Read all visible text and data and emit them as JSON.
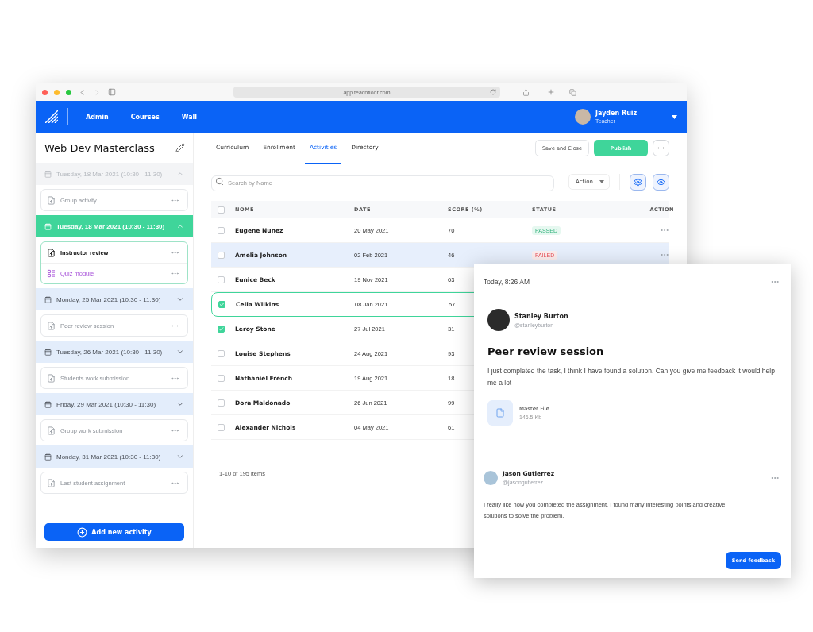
{
  "browser": {
    "url": "app.teachfloor.com"
  },
  "nav": {
    "items": [
      {
        "label": "Admin"
      },
      {
        "label": "Courses"
      },
      {
        "label": "Wall"
      }
    ],
    "user": {
      "name": "Jayden Ruiz",
      "role": "Teacher"
    }
  },
  "course": {
    "title": "Web Dev Masterclass"
  },
  "sessions": [
    {
      "date": "Tuesday, 18 Mar 2021 (10:30 - 11:30)",
      "dimmed": true,
      "selected": false,
      "expanded": true,
      "activities": [
        {
          "title": "Group activity",
          "kind": "assignment",
          "active": false
        }
      ]
    },
    {
      "date": "Tuesday, 18 Mar 2021 (10:30 - 11:30)",
      "dimmed": false,
      "selected": true,
      "expanded": true,
      "activities": [
        {
          "title": "Instructor review",
          "kind": "assignment",
          "active": true
        },
        {
          "title": "Quiz module",
          "kind": "quiz",
          "active": false
        }
      ]
    },
    {
      "date": "Monday, 25 Mar 2021 (10:30 - 11:30)",
      "dimmed": false,
      "selected": false,
      "expanded": false,
      "activities": [
        {
          "title": "Peer review session",
          "kind": "assignment",
          "active": false
        }
      ]
    },
    {
      "date": "Tuesday, 26 Mar 2021 (10:30 - 11:30)",
      "dimmed": false,
      "selected": false,
      "expanded": false,
      "activities": [
        {
          "title": "Students work submission",
          "kind": "assignment",
          "active": false
        }
      ]
    },
    {
      "date": "Friday, 29 Mar 2021 (10:30 - 11:30)",
      "dimmed": false,
      "selected": false,
      "expanded": false,
      "activities": [
        {
          "title": "Group work submission",
          "kind": "assignment",
          "active": false
        }
      ]
    },
    {
      "date": "Monday, 31 Mar 2021 (10:30 - 11:30)",
      "dimmed": false,
      "selected": false,
      "expanded": false,
      "activities": [
        {
          "title": "Last student assignment",
          "kind": "assignment",
          "active": false
        }
      ]
    }
  ],
  "add_button": "Add new activity",
  "tabs": [
    {
      "label": "Curriculum",
      "selected": false
    },
    {
      "label": "Enrollment",
      "selected": false
    },
    {
      "label": "Activities",
      "selected": true
    },
    {
      "label": "Directory",
      "selected": false
    }
  ],
  "header_buttons": {
    "save": "Save and Close",
    "publish": "Publish"
  },
  "search": {
    "placeholder": "Search by Name"
  },
  "action_select": "Action",
  "table": {
    "all_checked": false,
    "columns": [
      "NOME",
      "DATE",
      "SCORE (%)",
      "STATUS",
      "ACTION"
    ],
    "rows": [
      {
        "name": "Eugene Nunez",
        "date": "20 May 2021",
        "score": "70",
        "status": {
          "label": "PASSED",
          "kind": "passed"
        },
        "checked": false,
        "highlighted": false,
        "focused": false
      },
      {
        "name": "Amelia Johnson",
        "date": "02 Feb 2021",
        "score": "46",
        "status": {
          "label": "FAILED",
          "kind": "failed"
        },
        "checked": false,
        "highlighted": true,
        "focused": false
      },
      {
        "name": "Eunice Beck",
        "date": "19 Nov 2021",
        "score": "63",
        "checked": false,
        "highlighted": false,
        "focused": false
      },
      {
        "name": "Celia Wilkins",
        "date": "08 Jan 2021",
        "score": "57",
        "checked": true,
        "highlighted": false,
        "focused": true
      },
      {
        "name": "Leroy Stone",
        "date": "27 Jul 2021",
        "score": "31",
        "checked": true,
        "highlighted": false,
        "focused": false
      },
      {
        "name": "Louise Stephens",
        "date": "24 Aug 2021",
        "score": "93",
        "checked": false,
        "highlighted": false,
        "focused": false
      },
      {
        "name": "Nathaniel French",
        "date": "19 Aug 2021",
        "score": "18",
        "checked": false,
        "highlighted": false,
        "focused": false
      },
      {
        "name": "Dora Maldonado",
        "date": "26 Jun 2021",
        "score": "99",
        "checked": false,
        "highlighted": false,
        "focused": false
      },
      {
        "name": "Alexander Nichols",
        "date": "04 May 2021",
        "score": "61",
        "checked": false,
        "highlighted": false,
        "focused": false
      }
    ]
  },
  "pagination": "1-10 of 195 items",
  "post": {
    "time": "Today, 8:26 AM",
    "author": {
      "name": "Stanley Burton",
      "handle": "@stanleyburton"
    },
    "title": "Peer review session",
    "body": "I just completed the task, I think I have found a solution. Can you give me feedback it would help me a lot",
    "attachment": {
      "name": "Master File",
      "size": "146.5 Kb"
    },
    "reply": {
      "name": "Jason Gutierrez",
      "handle": "@jasongutierrez",
      "body": "I really like how you completed the assignment, I found many interesting points and creative solutions to solve the problem."
    },
    "button": "Send feedback"
  }
}
